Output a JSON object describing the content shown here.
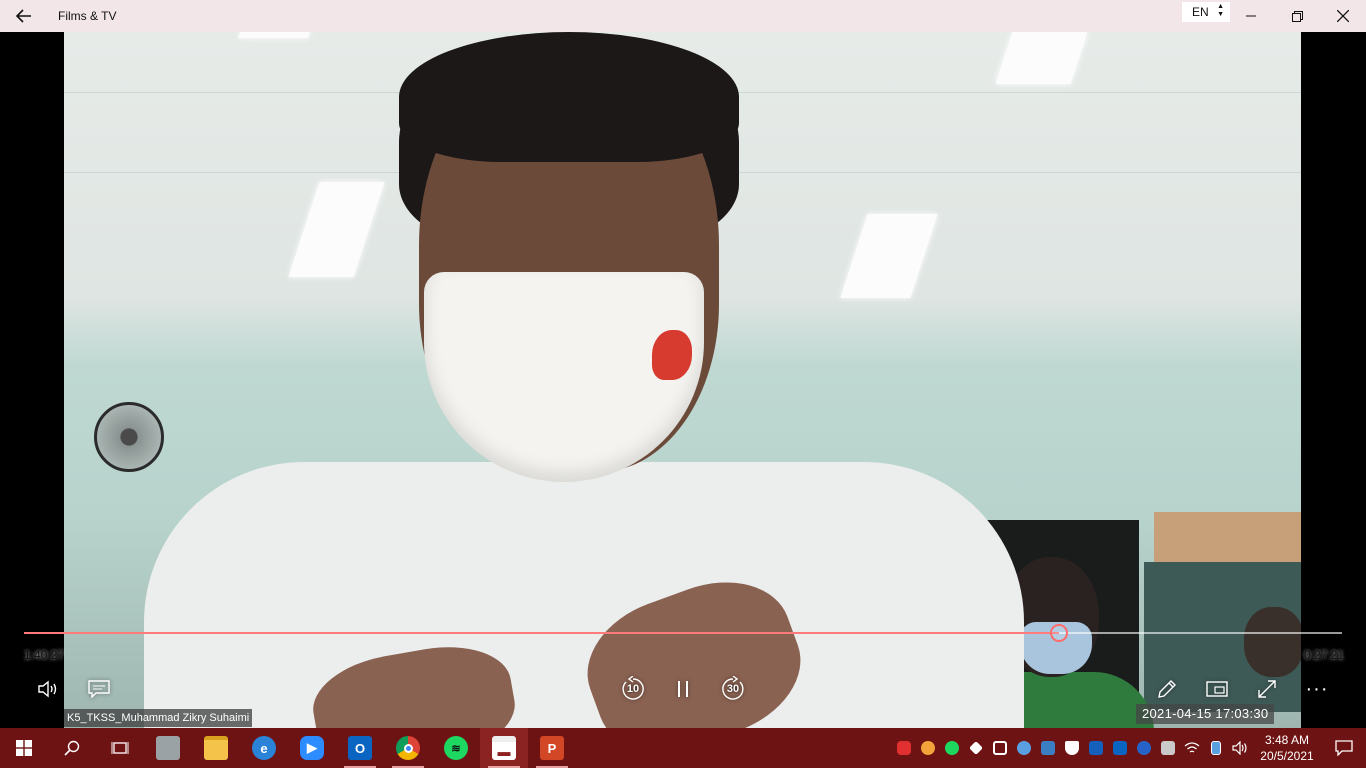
{
  "window": {
    "title": "Films & TV",
    "language": "EN"
  },
  "player": {
    "time_elapsed": "1:40:27",
    "time_remaining": "0:27:21",
    "progress_fraction": 0.785,
    "skip_back_seconds": "10",
    "skip_forward_seconds": "30",
    "more_label": "···"
  },
  "video_overlay": {
    "participant_name": "K5_TKSS_Muhammad Zikry Suhaimi",
    "recording_timestamp": "2021-04-15  17:03:30"
  },
  "taskbar": {
    "apps": [
      {
        "name": "explorer-icon"
      },
      {
        "name": "internet-explorer-icon"
      },
      {
        "name": "zoom-icon"
      },
      {
        "name": "outlook-icon"
      },
      {
        "name": "chrome-icon"
      },
      {
        "name": "spotify-icon"
      },
      {
        "name": "films-tv-icon"
      },
      {
        "name": "powerpoint-icon"
      }
    ],
    "clock_time": "3:48 AM",
    "clock_date": "20/5/2021"
  },
  "colors": {
    "taskbar": "#6e1313",
    "titlebar": "#f2e6e9",
    "progress_accent": "#ff7a7a"
  }
}
